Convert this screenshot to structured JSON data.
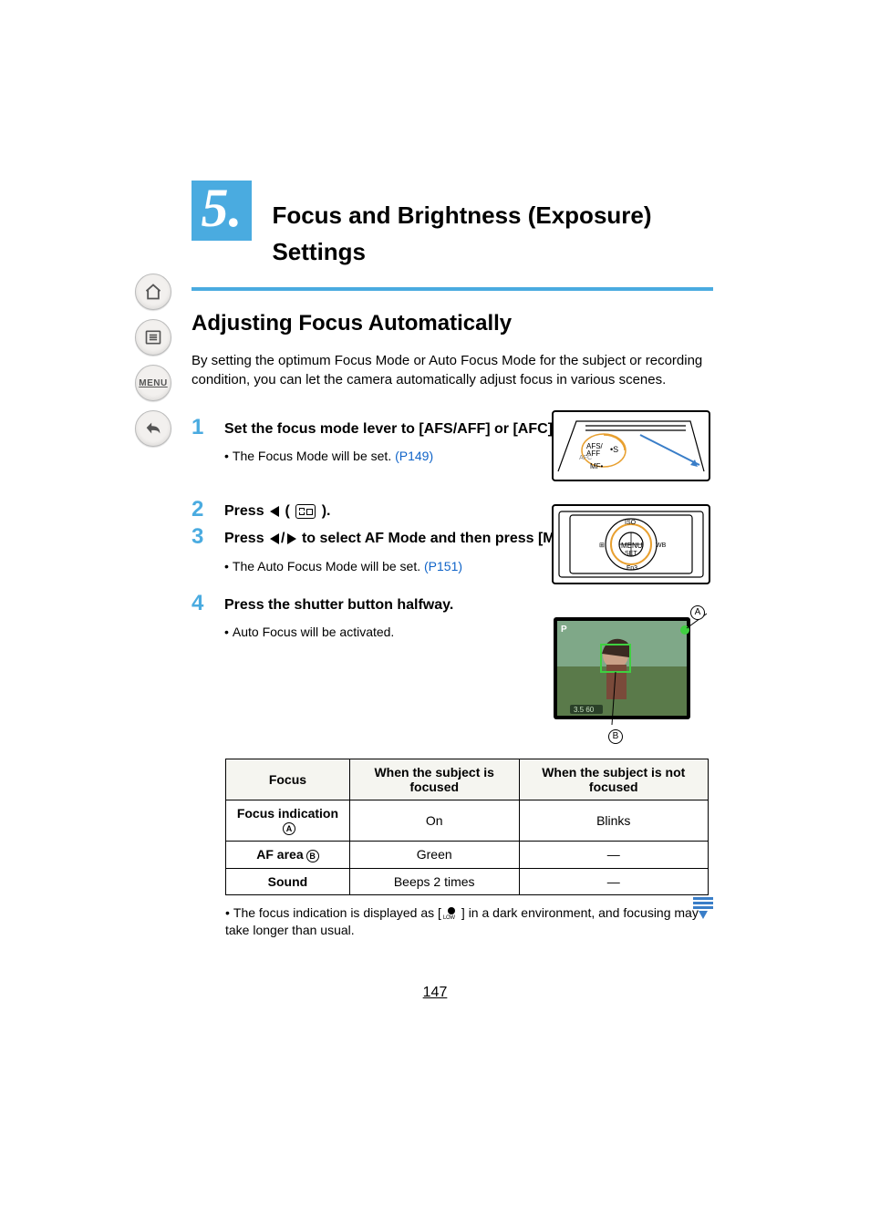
{
  "sidebar": {
    "menu_label": "MENU"
  },
  "chapter": {
    "number": "5.",
    "title": "Focus and Brightness (Exposure) Settings"
  },
  "section": {
    "title": "Adjusting Focus Automatically",
    "intro": "By setting the optimum Focus Mode or Auto Focus Mode for the subject or recording condition, you can let the camera automatically adjust focus in various scenes."
  },
  "steps": [
    {
      "num": "1",
      "title": "Set the focus mode lever to [AFS/AFF] or [AFC].",
      "note_prefix": "The Focus Mode will be set. ",
      "note_link": "(P149)"
    },
    {
      "num": "2",
      "title_prefix": "Press ",
      "title_mid": " ( ",
      "title_suffix": " )."
    },
    {
      "num": "3",
      "title_prefix": "Press ",
      "title_suffix": " to select AF Mode and then press [MENU/SET].",
      "note_prefix": "The Auto Focus Mode will be set. ",
      "note_link": "(P151)"
    },
    {
      "num": "4",
      "title": "Press the shutter button halfway.",
      "note_prefix": "Auto Focus will be activated."
    }
  ],
  "callouts": {
    "A": "A",
    "B": "B"
  },
  "chart_data": {
    "type": "table",
    "columns": [
      "Focus",
      "When the subject is focused",
      "When the subject is not focused"
    ],
    "rows": [
      {
        "label": "Focus indication",
        "badge": "A",
        "focused": "On",
        "not_focused": "Blinks"
      },
      {
        "label": "AF area",
        "badge": "B",
        "focused": "Green",
        "not_focused": "—"
      },
      {
        "label": "Sound",
        "badge": "",
        "focused": "Beeps 2 times",
        "not_focused": "—"
      }
    ]
  },
  "table_note_prefix": "The focus indication is displayed as [",
  "table_note_suffix": "] in a dark environment, and focusing may take longer than usual.",
  "page_number": "147"
}
